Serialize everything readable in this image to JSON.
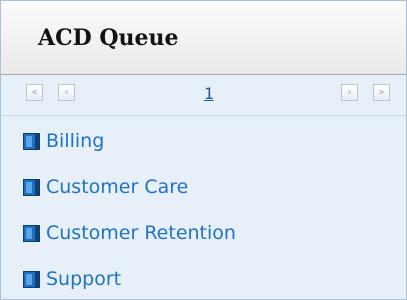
{
  "panel": {
    "title": "ACD Queue"
  },
  "pager": {
    "first_icon": "double-chevron-left-icon",
    "prev_icon": "chevron-left-icon",
    "page": "1",
    "next_icon": "chevron-right-icon",
    "last_icon": "double-chevron-right-icon"
  },
  "queues": [
    {
      "label": "Billing"
    },
    {
      "label": "Customer Care"
    },
    {
      "label": "Customer Retention"
    },
    {
      "label": "Support"
    }
  ]
}
